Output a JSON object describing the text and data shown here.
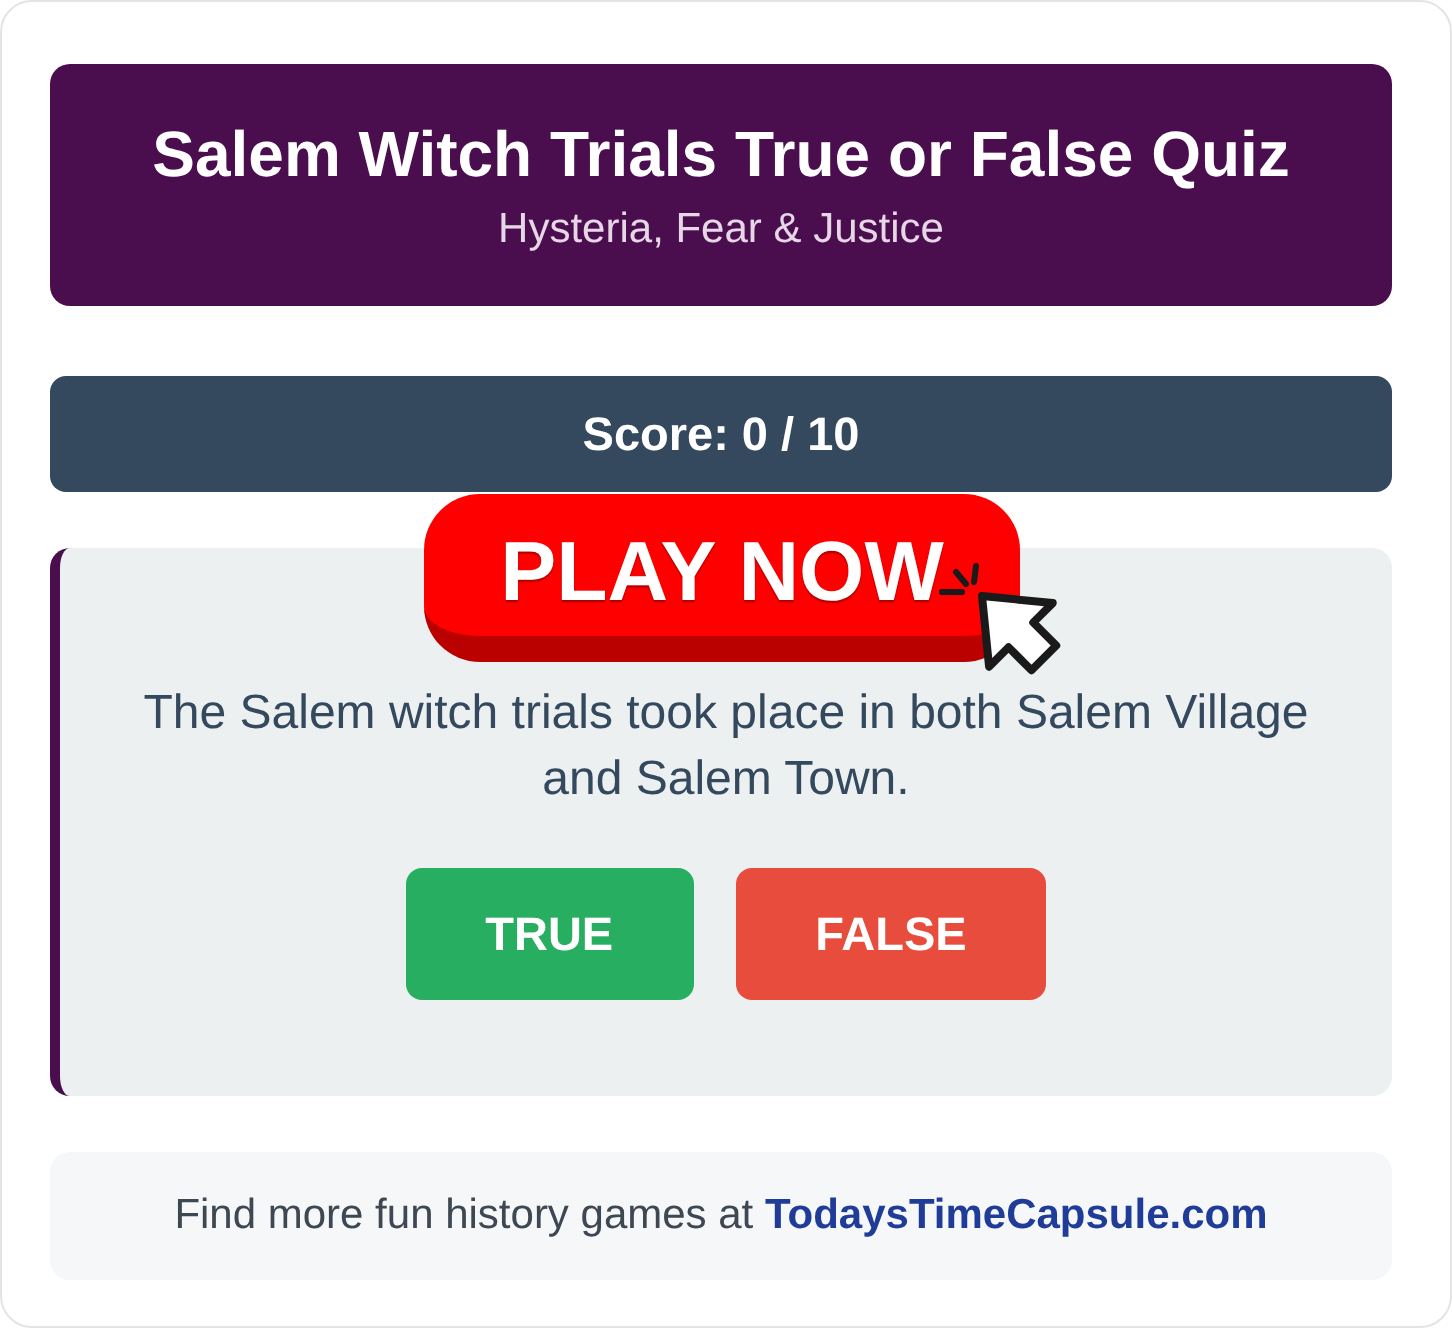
{
  "header": {
    "title": "Salem Witch Trials True or False Quiz",
    "subtitle": "Hysteria, Fear & Justice"
  },
  "score": {
    "text": "Score: 0 / 10"
  },
  "play_now": {
    "label": "PLAY NOW"
  },
  "question": {
    "text": "The Salem witch trials took place in both Salem Village and Salem Town.",
    "answers": [
      {
        "label": "TRUE",
        "kind": "true"
      },
      {
        "label": "FALSE",
        "kind": "false"
      }
    ]
  },
  "footer": {
    "text": "Find more fun history games at",
    "link": "TodaysTimeCapsule.com"
  }
}
